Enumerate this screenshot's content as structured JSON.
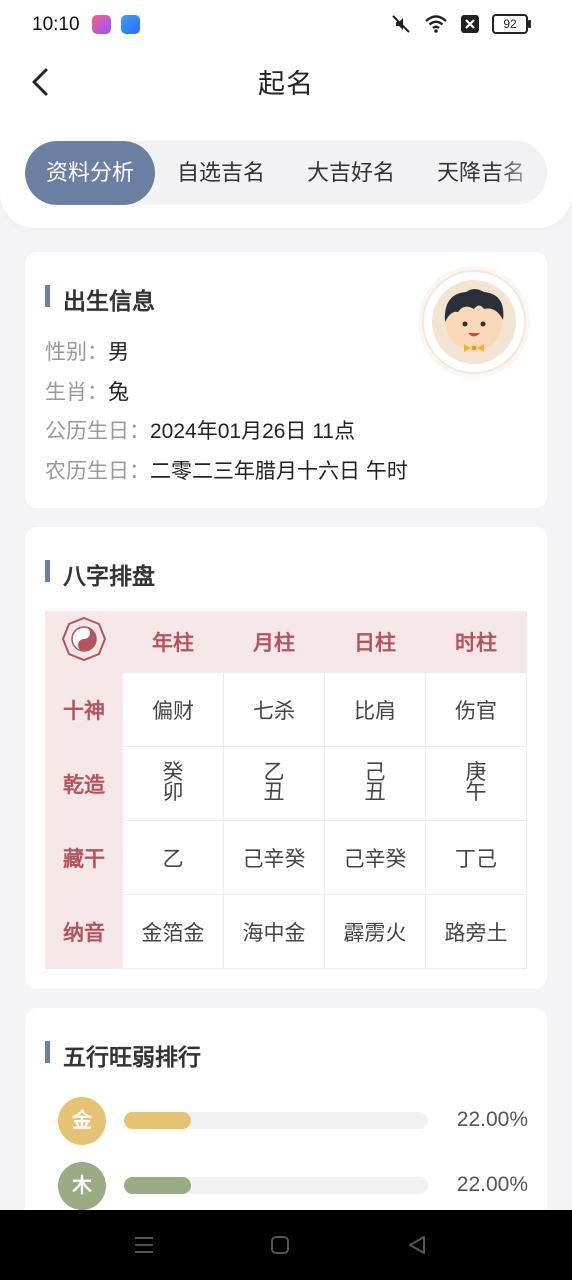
{
  "status_bar": {
    "time": "10:10",
    "battery": "92"
  },
  "header": {
    "title": "起名"
  },
  "tabs": [
    {
      "label": "资料分析",
      "active": true
    },
    {
      "label": "自选吉名",
      "active": false
    },
    {
      "label": "大吉好名",
      "active": false
    },
    {
      "label": "天降吉名",
      "active": false
    }
  ],
  "birth_info": {
    "title": "出生信息",
    "rows": [
      {
        "label": "性别：",
        "value": "男"
      },
      {
        "label": "生肖：",
        "value": "兔"
      },
      {
        "label": "公历生日：",
        "value": "2024年01月26日 11点"
      },
      {
        "label": "农历生日：",
        "value": "二零二三年腊月十六日 午时"
      }
    ]
  },
  "bazi": {
    "title": "八字排盘",
    "columns": [
      "年柱",
      "月柱",
      "日柱",
      "时柱"
    ],
    "rows": [
      {
        "label": "十神",
        "cells": [
          "偏财",
          "七杀",
          "比肩",
          "伤官"
        ]
      },
      {
        "label": "乾造",
        "cells": [
          [
            "癸",
            "卯"
          ],
          [
            "乙",
            "丑"
          ],
          [
            "己",
            "丑"
          ],
          [
            "庚",
            "午"
          ]
        ]
      },
      {
        "label": "藏干",
        "cells": [
          "乙",
          "己辛癸",
          "己辛癸",
          "丁己"
        ]
      },
      {
        "label": "纳音",
        "cells": [
          "金箔金",
          "海中金",
          "霹雳火",
          "路旁土"
        ]
      }
    ]
  },
  "wuxing": {
    "title": "五行旺弱排行",
    "items": [
      {
        "name": "金",
        "percent": "22.00%",
        "fraction": 0.22,
        "color": "#e6c374"
      },
      {
        "name": "木",
        "percent": "22.00%",
        "fraction": 0.22,
        "color": "#9aab86"
      }
    ]
  },
  "colors": {
    "accent": "#6b7fa3",
    "bazi_header_bg": "#f5e6e7",
    "bazi_header_text": "#b3545e"
  }
}
